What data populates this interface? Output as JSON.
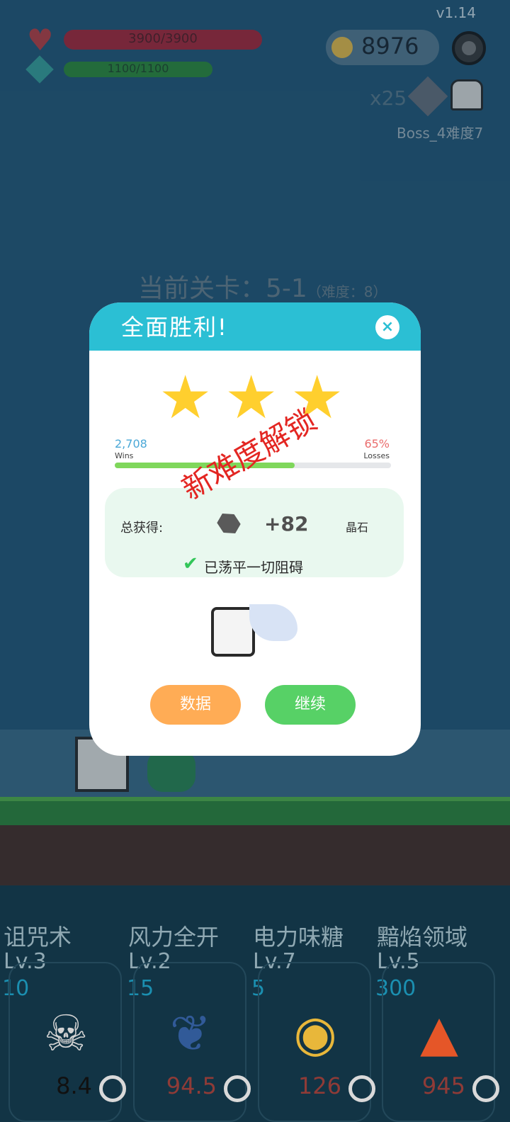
{
  "hud": {
    "version": "v1.14",
    "hp_text": "3900/3900",
    "mp_text": "1100/1100",
    "coins": "8976",
    "multiplier": "x25",
    "boss": "Boss_4难度7"
  },
  "stage": {
    "label": "当前关卡：5-1",
    "difficulty": "（难度：8）"
  },
  "dialog": {
    "title": "全面胜利!",
    "close_icon": "×",
    "stars": 3,
    "wins_value": "2,708",
    "wins_label": "Wins",
    "losses_value": "65%",
    "losses_label": "Losses",
    "stamp": "新难度解锁",
    "reward_label": "总获得:",
    "reward_amount": "+82",
    "reward_name": "晶石",
    "cleared_text": "已荡平一切阻碍",
    "btn_stats": "数据",
    "btn_continue": "继续"
  },
  "skills": [
    {
      "name": "诅咒术",
      "level": "Lv.3",
      "cost": "10",
      "value": "8.4",
      "icon": "skull-icon"
    },
    {
      "name": "风力全开",
      "level": "Lv.2",
      "cost": "15",
      "value": "94.5",
      "icon": "feather-icon"
    },
    {
      "name": "电力味糖",
      "level": "Lv.7",
      "cost": "5",
      "value": "126",
      "icon": "lollipop-icon"
    },
    {
      "name": "黯焰领域",
      "level": "Lv.5",
      "cost": "300",
      "value": "945",
      "icon": "campfire-icon"
    }
  ],
  "colors": {
    "sky": "#245a7b",
    "dialog_header": "#2bbfd4",
    "btn_stats": "#ffac55",
    "btn_continue": "#57d166"
  }
}
